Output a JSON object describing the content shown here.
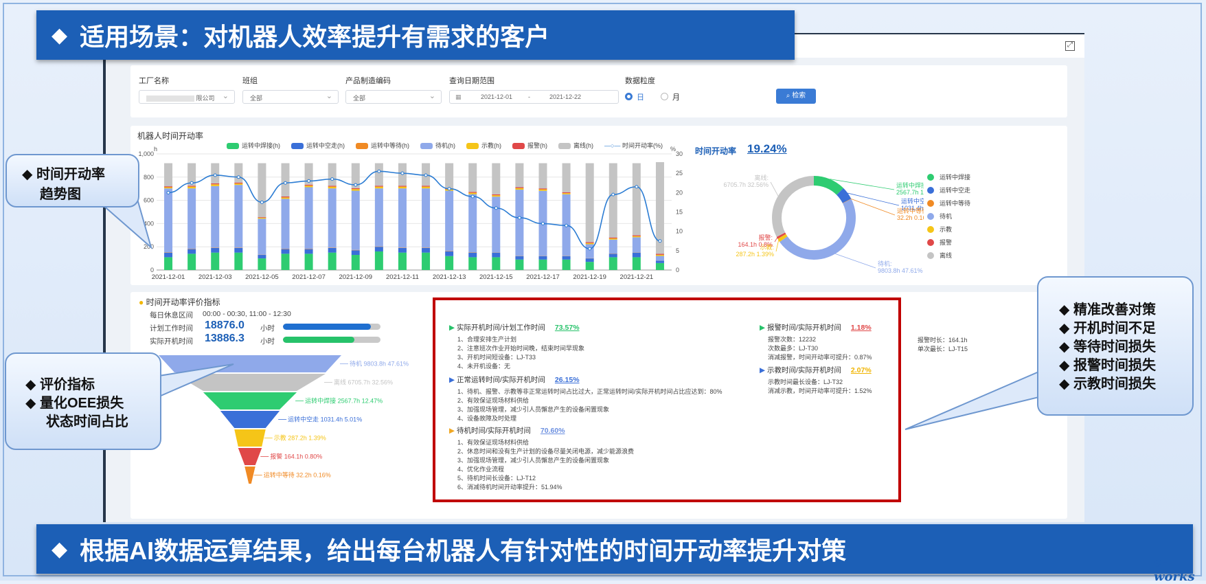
{
  "banner_top": {
    "text": "适用场景：对机器人效率提升有需求的客户"
  },
  "banner_bottom": {
    "text": "根据AI数据运算结果，给出每台机器人有针对性的时间开动率提升对策"
  },
  "diamond": "◆",
  "filters": {
    "factory": {
      "label": "工厂名称",
      "value": "限公司"
    },
    "team": {
      "label": "班组",
      "value": "全部"
    },
    "product": {
      "label": "产品制造编码",
      "value": "全部"
    },
    "date": {
      "label": "查询日期范围",
      "start": "2021-12-01",
      "sep": "-",
      "end": "2021-12-22"
    },
    "granularity": {
      "label": "数据粒度",
      "opt_day": "日",
      "opt_month": "月"
    },
    "search_label": "检索"
  },
  "chart_panel": {
    "title": "机器人时间开动率",
    "unit_left": "h",
    "unit_right": "%",
    "rate_label": "时间开动率",
    "rate_value": "19.24%"
  },
  "chart_data": {
    "type": "bar",
    "title": "机器人时间开动率",
    "ylabel": "h",
    "y2label": "%",
    "ylim": [
      0,
      1000
    ],
    "y2lim": [
      0,
      30
    ],
    "yticks": [
      0,
      200,
      400,
      600,
      800,
      "1,000"
    ],
    "y2ticks": [
      0,
      5,
      10,
      15,
      20,
      25,
      30
    ],
    "categories": [
      "2021-12-01",
      "2021-12-02",
      "2021-12-03",
      "2021-12-04",
      "2021-12-05",
      "2021-12-06",
      "2021-12-07",
      "2021-12-08",
      "2021-12-09",
      "2021-12-10",
      "2021-12-11",
      "2021-12-12",
      "2021-12-13",
      "2021-12-14",
      "2021-12-15",
      "2021-12-16",
      "2021-12-17",
      "2021-12-18",
      "2021-12-19",
      "2021-12-20",
      "2021-12-21",
      "2021-12-22"
    ],
    "x_tick_labels": [
      "2021-12-01",
      "2021-12-03",
      "2021-12-05",
      "2021-12-07",
      "2021-12-09",
      "2021-12-11",
      "2021-12-13",
      "2021-12-15",
      "2021-12-17",
      "2021-12-19",
      "2021-12-21"
    ],
    "series": [
      {
        "name": "运转中焊接(h)",
        "color": "#2ecc71",
        "values": [
          110,
          140,
          150,
          150,
          100,
          140,
          140,
          150,
          130,
          160,
          150,
          150,
          120,
          110,
          110,
          90,
          90,
          90,
          70,
          110,
          110,
          60
        ]
      },
      {
        "name": "运转中空走(h)",
        "color": "#3a6fd8",
        "values": [
          40,
          40,
          40,
          40,
          30,
          40,
          40,
          40,
          40,
          40,
          40,
          40,
          40,
          40,
          40,
          30,
          30,
          30,
          30,
          30,
          40,
          20
        ]
      },
      {
        "name": "运转中等待(h)",
        "color": "#f08a24",
        "values": [
          3,
          3,
          3,
          3,
          2,
          3,
          3,
          3,
          3,
          3,
          3,
          3,
          3,
          3,
          2,
          2,
          2,
          2,
          2,
          2,
          2,
          1
        ]
      },
      {
        "name": "待机(h)",
        "color": "#8fa9ea",
        "values": [
          550,
          520,
          530,
          540,
          310,
          430,
          530,
          510,
          510,
          500,
          510,
          510,
          520,
          500,
          480,
          570,
          560,
          530,
          120,
          120,
          130,
          40
        ]
      },
      {
        "name": "示教(h)",
        "color": "#f5c518",
        "values": [
          10,
          15,
          15,
          12,
          8,
          12,
          14,
          15,
          14,
          15,
          15,
          15,
          12,
          12,
          12,
          13,
          13,
          10,
          10,
          10,
          10,
          10
        ]
      },
      {
        "name": "报警(h)",
        "color": "#e04848",
        "values": [
          8,
          8,
          8,
          8,
          5,
          8,
          8,
          8,
          8,
          8,
          8,
          8,
          8,
          8,
          8,
          8,
          8,
          8,
          8,
          8,
          8,
          8
        ]
      },
      {
        "name": "离线(h)",
        "color": "#c4c4c4",
        "values": [
          199,
          194,
          174,
          167,
          465,
          287,
          185,
          194,
          215,
          194,
          194,
          194,
          217,
          247,
          268,
          207,
          217,
          250,
          680,
          640,
          620,
          790
        ]
      }
    ],
    "line": {
      "name": "时间开动率(%)",
      "color": "#2b7cd3",
      "values": [
        20,
        22.5,
        24.5,
        24,
        17.5,
        22.5,
        23,
        23.5,
        22,
        25.5,
        25,
        24.5,
        21,
        19,
        16,
        13.5,
        12,
        11.5,
        5.5,
        19.5,
        21.5,
        7.5
      ]
    },
    "donut": {
      "slices": [
        {
          "name": "运转中焊接",
          "label": "运转中焊接:",
          "value_label": "2567.7h 12.47%",
          "value": 2567.7,
          "color": "#2ecc71"
        },
        {
          "name": "运转中空走",
          "label": "运转中空走:",
          "value_label": "1031.4h 5.01%",
          "value": 1031.4,
          "color": "#3a6fd8"
        },
        {
          "name": "运转中等待",
          "label": "运转中等待:",
          "value_label": "32.2h 0.16%",
          "value": 32.2,
          "color": "#f08a24"
        },
        {
          "name": "待机",
          "label": "待机:",
          "value_label": "9803.8h 47.61%",
          "value": 9803.8,
          "color": "#8fa9ea"
        },
        {
          "name": "示教",
          "label": "示教:",
          "value_label": "287.2h 1.39%",
          "value": 287.2,
          "color": "#f5c518"
        },
        {
          "name": "报警",
          "label": "报警:",
          "value_label": "164.1h 0.8%",
          "value": 164.1,
          "color": "#e04848"
        },
        {
          "name": "离线",
          "label": "离线:",
          "value_label": "6705.7h 32.56%",
          "value": 6705.7,
          "color": "#c4c4c4"
        }
      ]
    },
    "funnel": [
      {
        "label": "待机 9803.8h 47.61%",
        "value": 47.61,
        "color": "#8fa9ea"
      },
      {
        "label": "离线 6705.7h 32.56%",
        "value": 32.56,
        "color": "#c4c4c4"
      },
      {
        "label": "运转中焊接 2567.7h 12.47%",
        "value": 12.47,
        "color": "#2ecc71"
      },
      {
        "label": "运转中空走 1031.4h 5.01%",
        "value": 5.01,
        "color": "#3a6fd8"
      },
      {
        "label": "示教 287.2h 1.39%",
        "value": 1.39,
        "color": "#f5c518"
      },
      {
        "label": "报警 164.1h 0.80%",
        "value": 0.8,
        "color": "#e04848"
      },
      {
        "label": "运转中等待 32.2h 0.16%",
        "value": 0.16,
        "color": "#f08a24"
      }
    ]
  },
  "eval_panel": {
    "title": "时间开动率评价指标",
    "rest_label": "每日休息区间",
    "rest_value": "00:00 - 00:30, 11:00 - 12:30",
    "plan_label": "计划工作时间",
    "plan_value": "18876.0",
    "plan_unit": "小时",
    "plan_fill": 0.9,
    "actual_label": "实际开机时间",
    "actual_value": "13886.3",
    "actual_unit": "小时",
    "actual_fill": 0.73
  },
  "analysis": {
    "s1": {
      "title": "实际开机时间/计划工作时间",
      "value": "73.57%",
      "items": [
        "1、合理安排生产计划",
        "2、注意班次作业开始时间晚，结束时间早现象",
        "3、开机时间短设备：LJ-T33",
        "4、未开机设备：无"
      ]
    },
    "s2": {
      "title": "正常运转时间/实际开机时间",
      "value": "26.15%",
      "items": [
        "1、待机、报警、示教等非正常运转时间占比过大，正常运转时间/实际开机时间占比应达到：80%",
        "2、有效保证现场材料供给",
        "3、加强现场管理，减少引人员懈怠产生的设备闲置现象",
        "4、设备故障及时处理"
      ]
    },
    "s3": {
      "title": "待机时间/实际开机时间",
      "value": "70.60%",
      "items": [
        "1、有效保证现场材料供给",
        "2、休息时间和没有生产计划的设备尽量关闭电源，减少能源浪费",
        "3、加强现场管理，减少引人员懈怠产生的设备闲置现象",
        "4、优化作业流程",
        "5、待机时间长设备：LJ-T12",
        "6、消减待机时间开动率提升：51.94%"
      ]
    },
    "s4": {
      "title": "报警时间/实际开机时间",
      "value": "1.18%",
      "items": [
        "报警次数：12232",
        "次数最多：LJ-T30",
        "消减报警，时间开动率可提升：0.87%"
      ]
    },
    "s4_side": [
      "报警时长：164.1h",
      "单次最长：LJ-T15"
    ],
    "s5": {
      "title": "示教时间/实际开机时间",
      "value": "2.07%",
      "items": [
        "示教时间最长设备：LJ-T32",
        "消减示教，时间开动率可提升：1.52%"
      ]
    }
  },
  "callouts": {
    "trend": [
      "时间开动率",
      "趋势图"
    ],
    "eval": [
      "评价指标",
      "量化OEE损失",
      "状态时间占比"
    ],
    "actions": [
      "精准改善对策",
      "开机时间不足",
      "等待时间损失",
      "报警时间损失",
      "示教时间损失"
    ]
  },
  "logo": {
    "text": "e-works"
  }
}
